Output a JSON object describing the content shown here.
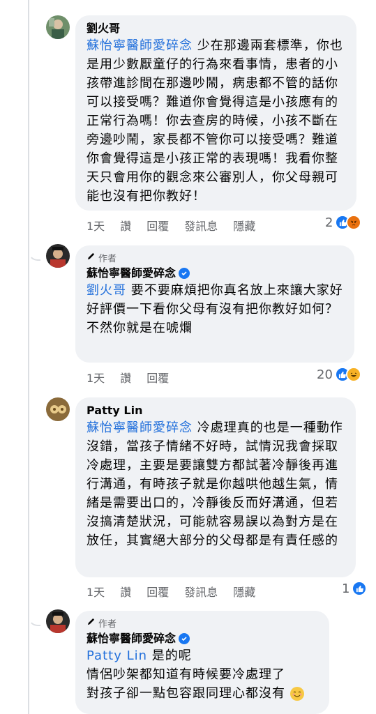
{
  "comments": [
    {
      "name": "劉火哥",
      "mention": "蘇怡寧醫師愛碎念",
      "text": "少在那邊兩套標準，你也是用少數厭童仔的行為來看事情，患者的小孩帶進診間在那邊吵鬧，病患都不管的話你可以接受嗎？難道你會覺得這是小孩應有的正常行為嗎！你去查房的時候，小孩不斷在旁邊吵鬧，家長都不管你可以接受嗎？難道你會覺得這是小孩正常的表現嗎！我看你整天只會用你的觀念來公審別人，你父母親可能也沒有把你教好！",
      "time": "1天",
      "like": "讚",
      "reply": "回覆",
      "message": "發訊息",
      "hide": "隱藏",
      "reaction_count": "2"
    },
    {
      "badge": "作者",
      "name": "蘇怡寧醫師愛碎念",
      "mention": "劉火哥",
      "text": "要不要麻煩把你真名放上來讓大家好好評價一下看你父母有沒有把你教好如何？",
      "text2": "不然你就是在唬爛",
      "time": "1天",
      "like": "讚",
      "reply": "回覆",
      "reaction_count": "20"
    },
    {
      "name": "Patty Lin",
      "mention": "蘇怡寧醫師愛碎念",
      "text": "冷處理真的也是一種動作沒錯，當孩子情緒不好時，試情況我會採取冷處理，主要是要讓雙方都試著冷靜後再進行溝通，有時孩子就是你越哄他越生氣，情緒是需要出口的，冷靜後反而好溝通，但若沒搞清楚狀況，可能就容易誤以為對方是在放任，其實絕大部分的父母都是有責任感的",
      "time": "1天",
      "like": "讚",
      "reply": "回覆",
      "message": "發訊息",
      "hide": "隱藏",
      "reaction_count": "1"
    },
    {
      "badge": "作者",
      "name": "蘇怡寧醫師愛碎念",
      "mention": "Patty Lin",
      "text": "是的呢",
      "text2": "情侶吵架都知道有時候要冷處理了",
      "text3": "對孩子卻一點包容跟同理心都沒有"
    }
  ],
  "colors": {
    "mention": "#216fdb",
    "bubble": "#f0f2f5",
    "like": "#1877f2"
  }
}
